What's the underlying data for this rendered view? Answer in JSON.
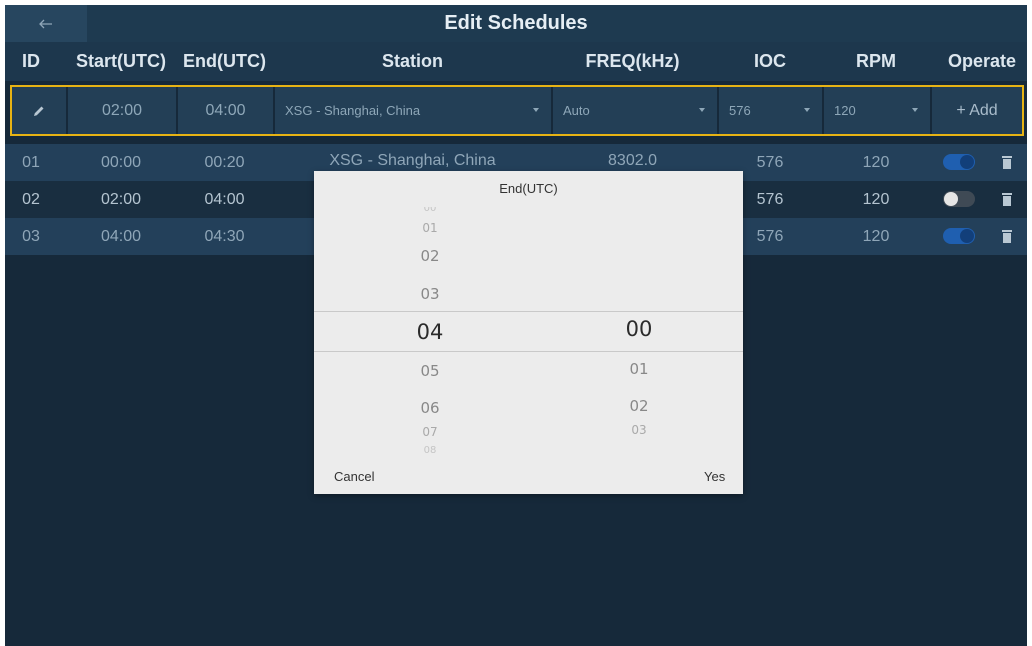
{
  "app": {
    "title": "Edit Schedules",
    "back_icon": "back-arrow-icon"
  },
  "columns": [
    "ID",
    "Start(UTC)",
    "End(UTC)",
    "Station",
    "FREQ(kHz)",
    "IOC",
    "RPM",
    "Operate"
  ],
  "add_row": {
    "edit_icon": "pencil-icon",
    "start": "02:00",
    "end": "04:00",
    "station": "XSG - Shanghai, China",
    "freq": "Auto",
    "ioc": "576",
    "rpm": "120",
    "add_label": "+  Add",
    "highlight_color": "#e7b314"
  },
  "rows": [
    {
      "id": "01",
      "start": "00:00",
      "end": "00:20",
      "station": "XSG - Shanghai, China",
      "freq": "8302.0",
      "ioc": "576",
      "rpm": "120",
      "enabled": true
    },
    {
      "id": "02",
      "start": "02:00",
      "end": "04:00",
      "station": "",
      "freq": "",
      "ioc": "576",
      "rpm": "120",
      "enabled": false
    },
    {
      "id": "03",
      "start": "04:00",
      "end": "04:30",
      "station": "",
      "freq": "",
      "ioc": "576",
      "rpm": "120",
      "enabled": true
    }
  ],
  "dialog": {
    "title": "End(UTC)",
    "hours": [
      "00",
      "01",
      "02",
      "03",
      "04",
      "05",
      "06",
      "07",
      "08"
    ],
    "minutes": [
      "00",
      "01",
      "02",
      "03"
    ],
    "selected_hour": "04",
    "selected_minute": "00",
    "cancel_label": "Cancel",
    "ok_label": "Yes"
  }
}
